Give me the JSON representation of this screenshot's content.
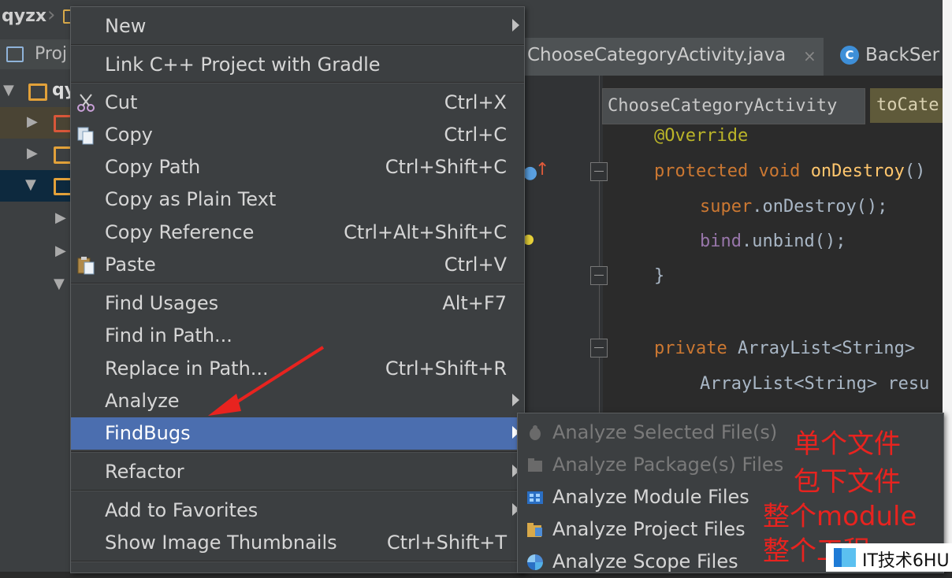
{
  "project_crumb": "qyzx",
  "project_tab_label": "Proj",
  "tree_label": "qy",
  "editor_tabs": [
    {
      "label": "ChooseCategoryActivity.java",
      "close": "×"
    },
    {
      "label": "BackSer",
      "icon": "C"
    }
  ],
  "breadcrumbs": [
    "ChooseCategoryActivity",
    "toCate"
  ],
  "code": {
    "annotation": "@Override",
    "line2_kw": "protected void ",
    "line2_fn": "onDestroy",
    "line2_rest": "()",
    "line3_kw": "super",
    "line3_rest": ".onDestroy();",
    "line4_field": "bind",
    "line4_rest": ".unbind();",
    "line5": "}",
    "line6_kw": "private ",
    "line6_rest": "ArrayList<String> ",
    "line7": "ArrayList<String> resu"
  },
  "context_menu": {
    "new": "New",
    "link_cpp": "Link C++ Project with Gradle",
    "cut": "Cut",
    "cut_sc": "Ctrl+X",
    "copy": "Copy",
    "copy_sc": "Ctrl+C",
    "copy_path": "Copy Path",
    "copy_path_sc": "Ctrl+Shift+C",
    "copy_plain": "Copy as Plain Text",
    "copy_ref": "Copy Reference",
    "copy_ref_sc": "Ctrl+Alt+Shift+C",
    "paste": "Paste",
    "paste_sc": "Ctrl+V",
    "find_usages": "Find Usages",
    "find_usages_sc": "Alt+F7",
    "find_in_path": "Find in Path...",
    "replace_in_path": "Replace in Path...",
    "replace_in_path_sc": "Ctrl+Shift+R",
    "analyze": "Analyze",
    "findbugs": "FindBugs",
    "refactor": "Refactor",
    "add_favorites": "Add to Favorites",
    "show_thumbnails": "Show Image Thumbnails",
    "show_thumbnails_sc": "Ctrl+Shift+T"
  },
  "submenu": {
    "selected_files": "Analyze Selected File(s)",
    "package_files": "Analyze Package(s) Files",
    "module_files": "Analyze Module Files",
    "project_files": "Analyze Project Files",
    "scope_files": "Analyze Scope Files"
  },
  "annotations": {
    "single_file": "单个文件",
    "package_files": "包下文件",
    "whole_module": "整个module",
    "whole_project": "整个工程"
  },
  "watermark": "IT技术6HU",
  "colors": {
    "menu_bg": "#3c3f41",
    "selection": "#4b6eaf",
    "annotation_red": "#e8231f"
  }
}
